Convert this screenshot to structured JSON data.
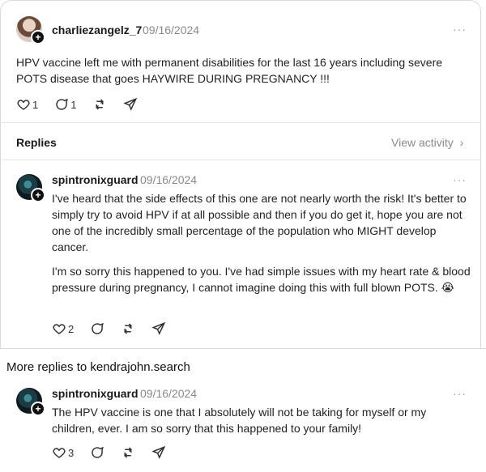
{
  "post": {
    "username": "charliezangelz_7",
    "date": "09/16/2024",
    "text": "HPV vaccine left me with permanent disabilities for the last 16 years including severe POTS disease that goes HAYWIRE DURING PREGNANCY !!!",
    "likes": "1",
    "comments": "1"
  },
  "replies_header": {
    "title": "Replies",
    "view_activity": "View activity"
  },
  "reply1": {
    "username": "spintronixguard",
    "date": "09/16/2024",
    "para1": "I've heard that the side effects of this one are not nearly worth the risk! It's better to simply try to avoid HPV if at all possible and then if you do get it, hope you are not one of the incredibly small percentage of the population who MIGHT develop cancer.",
    "para2": "I'm so sorry this happened to you. I've had simple issues with my heart rate & blood pressure during pregnancy, I cannot imagine doing this with full blown POTS. 😭",
    "likes": "2"
  },
  "more_replies": {
    "title": "More replies to kendrajohn.search"
  },
  "reply2": {
    "username": "spintronixguard",
    "date": "09/16/2024",
    "text": "The HPV vaccine is one that I absolutely will not be taking for myself or my children, ever. I am so sorry that this happened to your family!",
    "likes": "3"
  },
  "more_label": "···",
  "chevron": "›",
  "plus": "+",
  "icons": {
    "heart": "heart-icon",
    "comment": "comment-icon",
    "repost": "repost-icon",
    "share": "share-icon"
  }
}
